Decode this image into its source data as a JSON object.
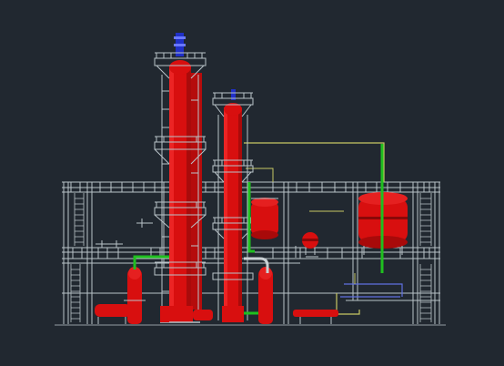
{
  "drawing": {
    "background": "#212830",
    "colors": {
      "steel": "#b9c3c8",
      "vessel": "#d80f0f",
      "vessel_dark": "#8a0808",
      "pipe_green": "#1fbf1f",
      "pipe_yellow": "#c8c864",
      "pipe_blue": "#6070e0",
      "cap_blue": "#2030c8"
    },
    "elements": {
      "main_column": "distillation-column",
      "secondary_column": "stripper-column",
      "left_drum": "horizontal-drum",
      "right_drum": "horizontal-drum",
      "sphere_tank": "spherical-tank",
      "pipe_rack": "pipe-rack",
      "structure": "steel-structure"
    }
  }
}
